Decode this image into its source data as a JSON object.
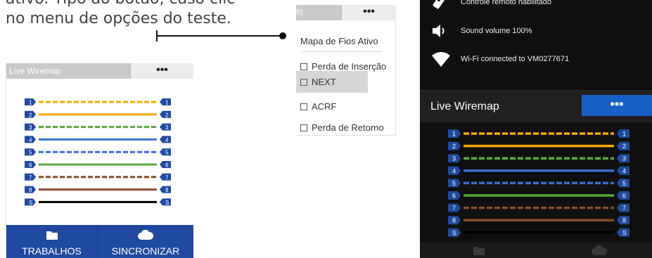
{
  "instruction": {
    "line1": "ativo. Tipo ao botão, caso clic",
    "line2": "no menu de opções do teste."
  },
  "left_panel": {
    "title": "Live Wiremap",
    "menu_button": "•••",
    "footer": {
      "jobs_label": "TRABALHOS",
      "sync_label": "SINCRONIZAR"
    }
  },
  "options_menu": {
    "header_fragment": "5)",
    "menu_button": "•••",
    "items": [
      {
        "label": "Mapa de Fios Ativo",
        "checkbox": false
      },
      {
        "label": "Perda de Inserção",
        "checkbox": true
      },
      {
        "label": "NEXT",
        "checkbox": true,
        "highlighted": true
      },
      {
        "label": "ACRF",
        "checkbox": true
      },
      {
        "label": "Perda de Retorno",
        "checkbox": true
      }
    ]
  },
  "right_panel": {
    "status": [
      {
        "icon": "remote-control-icon",
        "text": "Controle remoto habilitado"
      },
      {
        "icon": "speaker-icon",
        "text": "Sound volume 100%"
      },
      {
        "icon": "wifi-icon",
        "text": "Wi-Fi connected to VM0277671"
      }
    ],
    "title": "Live Wiremap",
    "menu_button": "•••"
  },
  "wiremap": {
    "pin_labels": [
      "1",
      "2",
      "3",
      "4",
      "5",
      "6",
      "7",
      "8",
      "S"
    ],
    "wire_colors": [
      "#f7a800",
      "#f7a800",
      "#58a83c",
      "#3b6fd1",
      "#3b6fd1",
      "#58a83c",
      "#8a4a2c",
      "#8a4a2c",
      "#000000"
    ],
    "wire_styles": [
      "dashed",
      "solid",
      "dashed",
      "solid",
      "dashed",
      "solid",
      "dashed",
      "solid",
      "solid"
    ],
    "pin_color": "#1f4aa0"
  },
  "colors": {
    "accent_blue": "#1860c3",
    "footer_blue": "#1f4aa0"
  }
}
